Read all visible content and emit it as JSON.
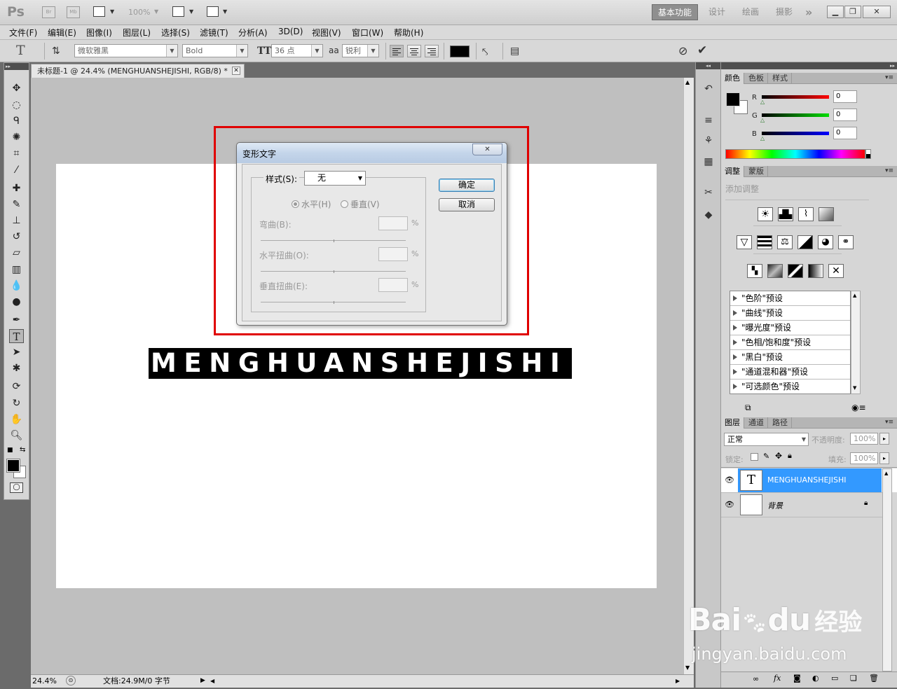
{
  "app": {
    "logo": "Ps",
    "bridge_badge": "Br",
    "minibridge_badge": "Mb",
    "zoom_level": "100%",
    "workspaces": [
      "基本功能",
      "设计",
      "绘画",
      "摄影"
    ],
    "more": "»"
  },
  "menu": [
    "文件(F)",
    "编辑(E)",
    "图像(I)",
    "图层(L)",
    "选择(S)",
    "滤镜(T)",
    "分析(A)",
    "3D(D)",
    "视图(V)",
    "窗口(W)",
    "帮助(H)"
  ],
  "options_bar": {
    "font_family": "微软雅黑",
    "font_style": "Bold",
    "font_size": "36 点",
    "aa_label": "a",
    "anti_alias": "锐利",
    "text_color": "#000000"
  },
  "document": {
    "tab_title": "未标题-1 @ 24.4% (MENGHUANSHEJISHI, RGB/8) *",
    "text_layer_content": "MENGHUANSHEJISHI",
    "status_zoom": "24.4%",
    "status_doc": "文档:24.9M/0 字节"
  },
  "warp_dialog": {
    "title": "变形文字",
    "style_label": "样式(S):",
    "style_value": "无",
    "horizontal": "水平(H)",
    "vertical": "垂直(V)",
    "bend_label": "弯曲(B):",
    "h_distortion_label": "水平扭曲(O):",
    "v_distortion_label": "垂直扭曲(E):",
    "percent": "%",
    "ok": "确定",
    "cancel": "取消"
  },
  "color_panel": {
    "tabs": [
      "颜色",
      "色板",
      "样式"
    ],
    "channels": [
      {
        "name": "R",
        "value": "0"
      },
      {
        "name": "G",
        "value": "0"
      },
      {
        "name": "B",
        "value": "0"
      }
    ]
  },
  "adjust_panel": {
    "tabs": [
      "调整",
      "蒙版"
    ],
    "title": "添加调整",
    "presets": [
      "\"色阶\"预设",
      "\"曲线\"预设",
      "\"曝光度\"预设",
      "\"色相/饱和度\"预设",
      "\"黑白\"预设",
      "\"通道混和器\"预设",
      "\"可选颜色\"预设"
    ]
  },
  "layers_panel": {
    "tabs": [
      "图层",
      "通道",
      "路径"
    ],
    "blend_mode": "正常",
    "opacity_label": "不透明度:",
    "opacity_value": "100%",
    "lock_label": "锁定:",
    "fill_label": "填充:",
    "fill_value": "100%",
    "layers": [
      {
        "name": "MENGHUANSHEJISHI",
        "thumb": "T"
      },
      {
        "name": "背景",
        "thumb": ""
      }
    ]
  },
  "watermark": {
    "brand": "Bai",
    "brand2": "du",
    "suffix": "经验",
    "url": "jingyan.baidu.com"
  },
  "colors": {
    "highlight": "#e00000",
    "selected_layer": "#3399ff"
  }
}
